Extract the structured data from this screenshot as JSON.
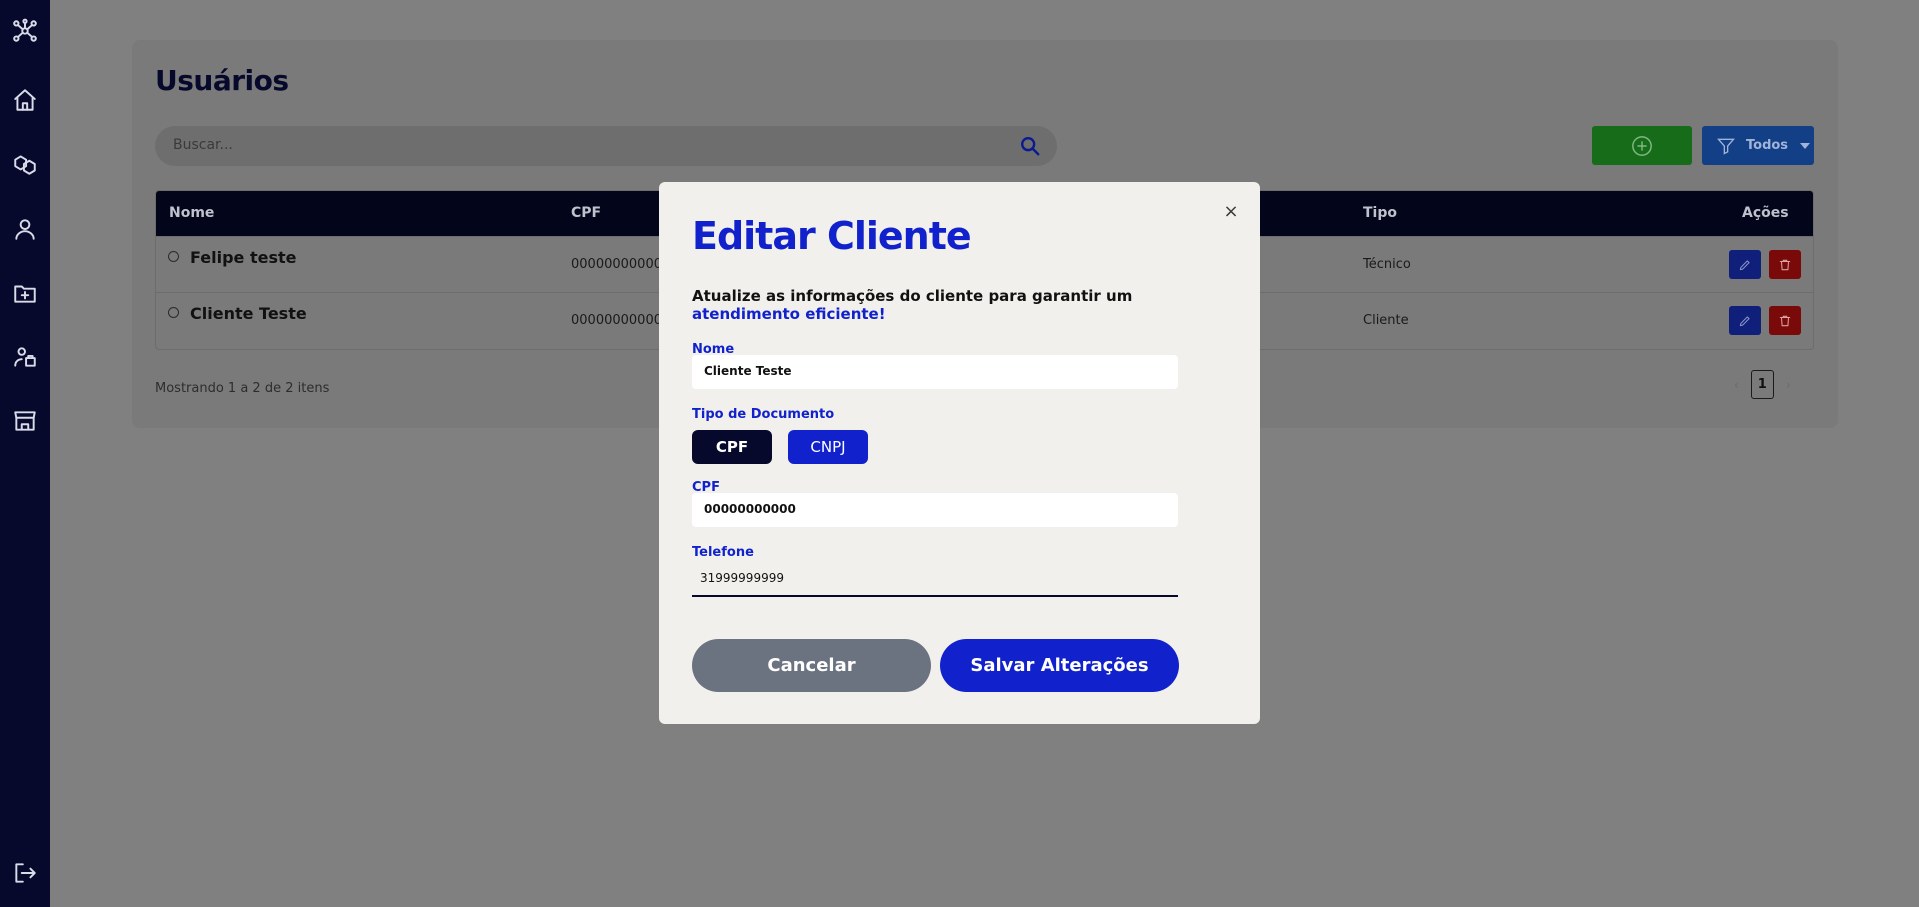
{
  "sidebar": {
    "icons": [
      "network-icon",
      "home-icon",
      "boxes-icon",
      "user-icon",
      "folder-plus-icon",
      "technician-icon",
      "store-icon",
      "logout-icon"
    ]
  },
  "page": {
    "title": "Usuários",
    "search_placeholder": "Buscar...",
    "filter_label": "Todos"
  },
  "table": {
    "headers": [
      "Nome",
      "CPF",
      "Tipo",
      "Ações"
    ],
    "rows": [
      {
        "name": "Felipe teste",
        "cpf": "00000000000",
        "tipo": "Técnico"
      },
      {
        "name": "Cliente Teste",
        "cpf": "00000000000",
        "tipo": "Cliente"
      }
    ]
  },
  "footer": {
    "showing": "Mostrando 1 a 2 de 2 itens",
    "current_page": "1",
    "prev": "‹",
    "next": "›"
  },
  "modal": {
    "close": "×",
    "title": "Editar Cliente",
    "description_line1": "Atualize as informações do cliente para garantir um",
    "description_line2": "atendimento eficiente!",
    "nome_label": "Nome",
    "nome_value": "Cliente Teste",
    "tipo_doc_label": "Tipo de Documento",
    "doc_options": [
      "CPF",
      "CNPJ"
    ],
    "cpf_label": "CPF",
    "cpf_value": "00000000000",
    "telefone_label": "Telefone",
    "telefone_value": "31999999999",
    "cancel_label": "Cancelar",
    "save_label": "Salvar Alterações"
  },
  "colors": {
    "brand_blue": "#1122cc",
    "navy": "#06092b",
    "success": "#22a726",
    "danger": "#c81010"
  }
}
